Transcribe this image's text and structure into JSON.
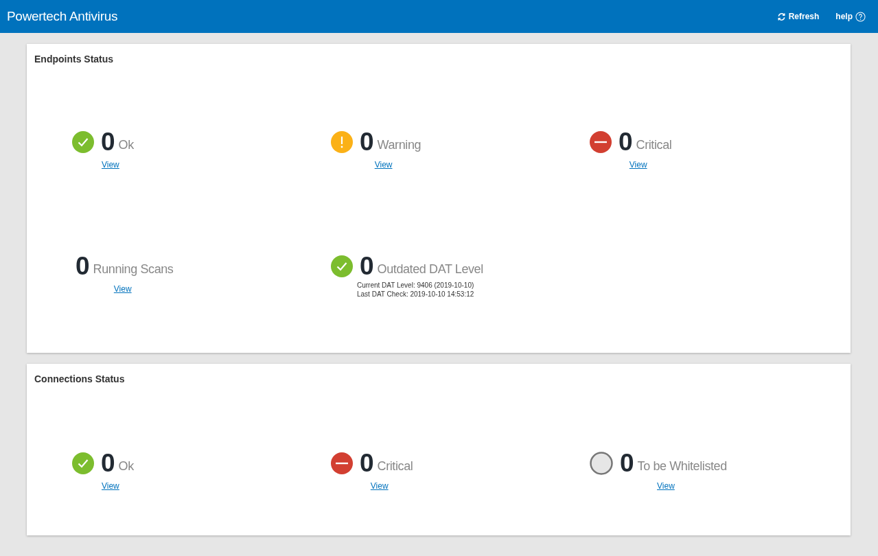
{
  "header": {
    "title": "Powertech Antivirus",
    "actions": [
      "Refresh",
      "help"
    ]
  },
  "panels": [
    {
      "title": "Endpoints Status",
      "tiles": [
        {
          "kind": "ok",
          "count": "0",
          "label": "Ok",
          "link": "View"
        },
        {
          "kind": "warning",
          "count": "0",
          "label": "Warning",
          "link": "View"
        },
        {
          "kind": "critical",
          "count": "0",
          "label": "Critical",
          "link": "View"
        },
        {
          "kind": "none",
          "count": "0",
          "label": "Running Scans",
          "link": "View"
        },
        {
          "kind": "ok",
          "count": "0",
          "label": "Outdated DAT Level",
          "details": [
            "Current DAT Level: 9406 (2019-10-10)",
            "Last DAT Check: 2019-10-10 14:53:12"
          ]
        }
      ]
    },
    {
      "title": "Connections Status",
      "tiles": [
        {
          "kind": "ok",
          "count": "0",
          "label": "Ok",
          "link": "View"
        },
        {
          "kind": "critical",
          "count": "0",
          "label": "Critical",
          "link": "View"
        },
        {
          "kind": "pending",
          "count": "0",
          "label": "To be Whitelisted",
          "link": "View"
        }
      ]
    }
  ]
}
